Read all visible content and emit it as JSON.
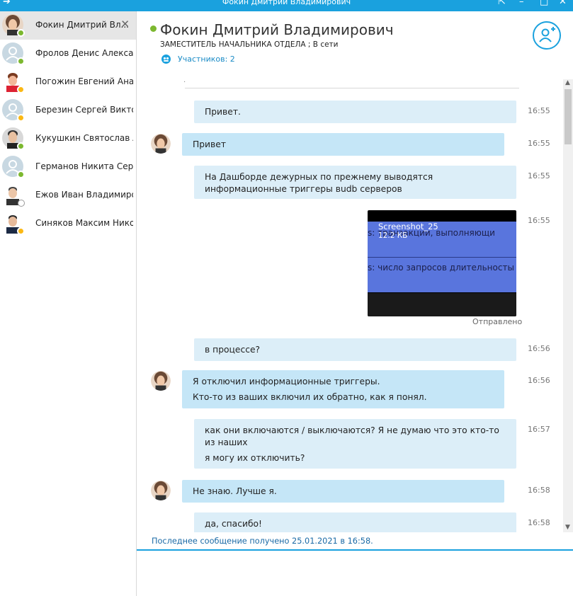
{
  "window": {
    "title": "Фокин Дмитрий Владимирович"
  },
  "contacts": [
    {
      "name": "Фокин Дмитрий Вл...",
      "status": "online",
      "active": true
    },
    {
      "name": "Фролов Денис Александ...",
      "status": "online"
    },
    {
      "name": "Погожин Евгений Анат...",
      "status": "away"
    },
    {
      "name": "Березин Сергей Виктор...",
      "status": "away"
    },
    {
      "name": "Кукушкин Святослав А...",
      "status": "online"
    },
    {
      "name": "Германов Никита Серг...",
      "status": "online"
    },
    {
      "name": "Ежов Иван Владимиро...",
      "status": "offline"
    },
    {
      "name": "Синяков Максим Нико...",
      "status": "away"
    }
  ],
  "header": {
    "name": "Фокин Дмитрий Владимирович",
    "role": "ЗАМЕСТИТЕЛЬ НАЧАЛЬНИКА ОТДЕЛА ;  В сети",
    "participants": "Участников: 2"
  },
  "messages": [
    {
      "text": [
        "Привет."
      ],
      "time": "16:55",
      "mine": true
    },
    {
      "text": [
        "Привет"
      ],
      "time": "16:55",
      "mine": false
    },
    {
      "text": [
        "На Дашборде дежурных по прежнему выводятся информационные триггеры вudb серверов"
      ],
      "time": "16:55",
      "mine": true
    },
    {
      "attachment": {
        "name": "Screenshot_25",
        "size": "12.2 КБ",
        "line1": "s:  транзакции, выполняющи",
        "line2": "s: число запросов длительносты"
      },
      "time": "16:55",
      "status": "Отправлено"
    },
    {
      "text": [
        "в процессе?"
      ],
      "time": "16:56",
      "mine": true
    },
    {
      "text": [
        "Я отключил информационные триггеры.",
        "Кто-то из ваших включил их обратно, как я понял."
      ],
      "time": "16:56",
      "mine": false
    },
    {
      "text": [
        "как они включаются / выключаются? Я не думаю что это кто-то из наших",
        "я могу их отключить?"
      ],
      "time": "16:57",
      "mine": true
    },
    {
      "text": [
        "Не знаю. Лучше я."
      ],
      "time": "16:58",
      "mine": false
    },
    {
      "text": [
        "да, спасибо!"
      ],
      "time": "16:58",
      "mine": true
    }
  ],
  "footer": {
    "last_message": "Последнее сообщение получено 25.01.2021 в 16:58."
  },
  "colors": {
    "accent": "#1aa1de",
    "bubble_in": "#c5e6f7",
    "bubble_out": "#dceef8",
    "online": "#7cb82f",
    "away": "#fbb814"
  },
  "icons": [
    "minimize-icon",
    "maximize-icon",
    "close-icon",
    "participants-icon",
    "add-person-icon",
    "status-online-icon"
  ]
}
